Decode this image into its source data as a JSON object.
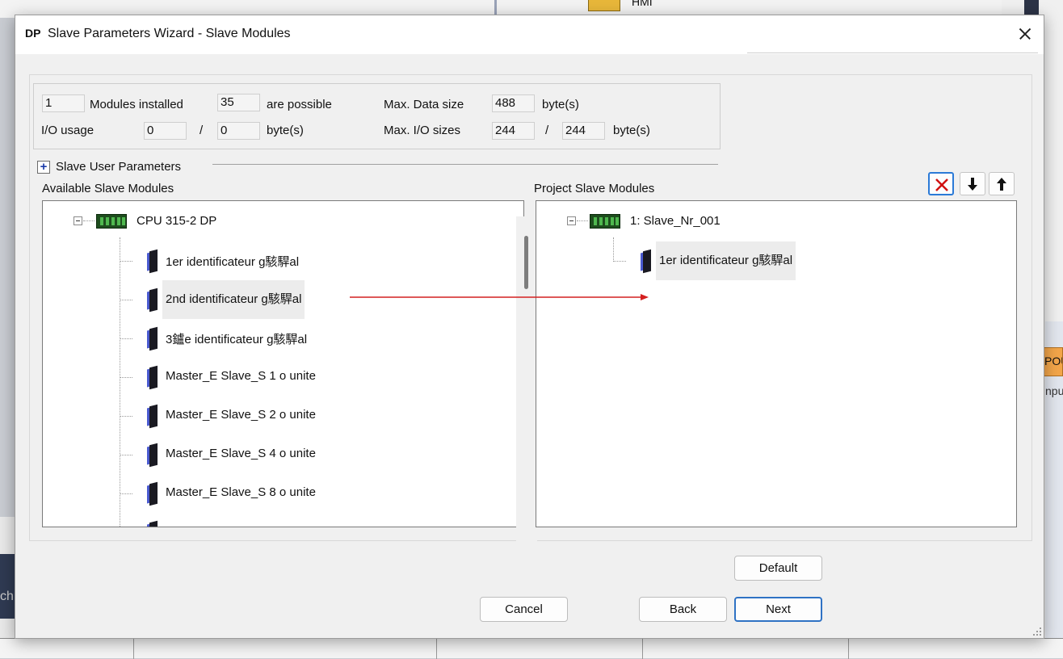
{
  "background": {
    "top_text": "HMI",
    "right_tab_text": "POU",
    "right_text": "npu",
    "left_text": "ch"
  },
  "dialog": {
    "logo": "DP",
    "title": "Slave Parameters Wizard - Slave Modules",
    "close_icon": "close-icon"
  },
  "info": {
    "modules_installed_value": "1",
    "modules_installed_label": "Modules installed",
    "possible_value": "35",
    "possible_label": "are possible",
    "max_data_size_label": "Max. Data size",
    "max_data_size_value": "488",
    "max_data_size_unit": "byte(s)",
    "io_usage_label": "I/O usage",
    "io_usage_in": "0",
    "io_usage_sep": "/",
    "io_usage_out": "0",
    "io_usage_unit": "byte(s)",
    "max_io_label": "Max. I/O sizes",
    "max_io_in": "244",
    "max_io_sep": "/",
    "max_io_out": "244",
    "max_io_unit": "byte(s)"
  },
  "slave_user_parameters": {
    "expander": "+",
    "label": "Slave User Parameters"
  },
  "available": {
    "header": "Available Slave Modules",
    "root": "CPU 315-2 DP",
    "items": [
      "1er identificateur g駭駻al",
      "2nd identificateur g駭駻al",
      "3鑪e identificateur g駭駻al",
      "Master_E Slave_S  1 o unite",
      "Master_E Slave_S  2 o unite",
      "Master_E Slave_S  4 o unite",
      "Master_E Slave_S  8 o unite"
    ],
    "selected_index": 1
  },
  "project": {
    "header": "Project Slave Modules",
    "root": "1: Slave_Nr_001",
    "items": [
      "1er identificateur g駭駻al"
    ],
    "toolbar": {
      "delete_icon": "delete-x-icon",
      "down_icon": "arrow-down-icon",
      "up_icon": "arrow-up-icon",
      "delete_color": "#d01010"
    }
  },
  "annotation": {
    "arrow_color": "#d42020"
  },
  "buttons": {
    "default": "Default",
    "cancel": "Cancel",
    "back": "Back",
    "next": "Next"
  },
  "colors": {
    "accent": "#2f72c4",
    "rack": "#1d4d1d",
    "module_edge": "#4a5ad0"
  }
}
